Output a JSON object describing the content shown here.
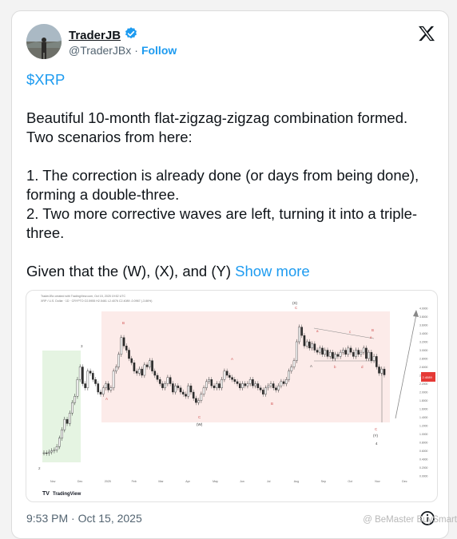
{
  "post": {
    "author_name": "TraderJB",
    "handle": "@TraderJBx",
    "separator": "·",
    "follow_label": "Follow",
    "cashtag": "$XRP",
    "paragraphs": [
      "Beautiful 10-month flat-zigzag-zigzag combination formed. Two scenarios from here:",
      "1. The correction is already done (or days from being done), forming a double-three.",
      "2. Two more corrective waves are left, turning it into a triple-three.",
      "Given that the (W), (X), and (Y)"
    ],
    "show_more": "Show more",
    "timestamp": "9:53 PM · Oct 15, 2025",
    "watermark": "@ BeMaster BuySmart"
  },
  "icons": {
    "verified": "verified-badge-icon",
    "x_logo": "x-logo-icon",
    "info": "info-icon"
  },
  "chart_data": {
    "type": "line",
    "header_line1": "TraderJBx created with TradingView.com, Oct 15, 2025 19:52 UTC",
    "header_line2": "XRP / U.S. Dollar · 1D · CRYPTO  O2.5955 H2.5461 L2.4076 C2.4089 -0.0967 (-3.86%)",
    "xticks": [
      "Nov",
      "Dec",
      "2025",
      "Feb",
      "Mar",
      "Apr",
      "May",
      "Jun",
      "Jul",
      "Aug",
      "Sep",
      "Oct",
      "Nov",
      "Dec"
    ],
    "yticks": [
      "4.0000",
      "3.8000",
      "3.6000",
      "3.4000",
      "3.2000",
      "3.0000",
      "2.8000",
      "2.6000",
      "2.4000",
      "2.2000",
      "2.0000",
      "1.8000",
      "1.6000",
      "1.4000",
      "1.2000",
      "1.0000",
      "0.8000",
      "0.6000",
      "0.4000",
      "0.2000",
      "0.0000"
    ],
    "ylim": [
      0,
      4
    ],
    "price_tag": "2.4089",
    "series": [
      {
        "values": [
          0.55,
          0.54,
          0.57,
          0.6,
          0.62,
          0.7,
          0.9,
          1.1,
          1.35,
          1.25,
          1.5,
          1.75,
          1.9,
          2.3,
          2.6,
          2.2,
          2.1,
          2.5,
          2.45,
          2.3,
          2.2,
          2.0,
          1.95,
          2.1,
          2.2,
          2.05,
          2.1,
          2.5,
          2.6,
          2.9,
          3.3,
          3.1,
          3.0,
          2.8,
          2.7,
          2.5,
          2.45,
          2.55,
          2.4,
          2.65,
          2.6,
          2.75,
          2.5,
          2.4,
          2.3,
          2.2,
          2.1,
          2.2,
          2.35,
          2.2,
          2.0,
          2.15,
          2.1,
          2.0,
          1.95,
          1.9,
          2.15,
          2.0,
          1.85,
          1.75,
          1.8,
          1.95,
          2.1,
          2.25,
          2.3,
          2.15,
          2.1,
          2.2,
          2.1,
          2.3,
          2.5,
          2.4,
          2.35,
          2.3,
          2.25,
          2.2,
          2.1,
          2.2,
          2.15,
          2.2,
          2.3,
          2.15,
          2.2,
          2.1,
          2.05,
          1.95,
          2.1,
          2.15,
          2.2,
          2.1,
          2.05,
          2.15,
          2.25,
          2.2,
          2.3,
          2.5,
          2.6,
          2.75,
          3.2,
          3.55,
          3.35,
          3.1,
          3.2,
          3.05,
          3.15,
          3.0,
          2.95,
          3.05,
          2.9,
          3.0,
          2.85,
          2.95,
          2.8,
          2.9,
          2.85,
          2.95,
          3.0,
          2.9,
          3.05,
          2.95,
          2.85,
          3.0,
          2.9,
          2.95,
          3.05,
          2.8,
          2.95,
          2.75,
          2.85,
          2.6,
          2.45,
          2.55,
          2.41
        ]
      }
    ],
    "labels": {
      "wave_2": "2",
      "wave_3": "3",
      "A1": "A",
      "B1": "B",
      "C1": "C",
      "W": "(W)",
      "A2": "A",
      "B2": "B",
      "X": "(X)",
      "C_top": "C",
      "A3": "A",
      "B3": "B",
      "a": "a",
      "b": "b",
      "c": "c",
      "d": "d",
      "e": "e",
      "C3": "C",
      "Y": "(Y)",
      "wave_4": "4"
    },
    "logo": "TradingView"
  }
}
